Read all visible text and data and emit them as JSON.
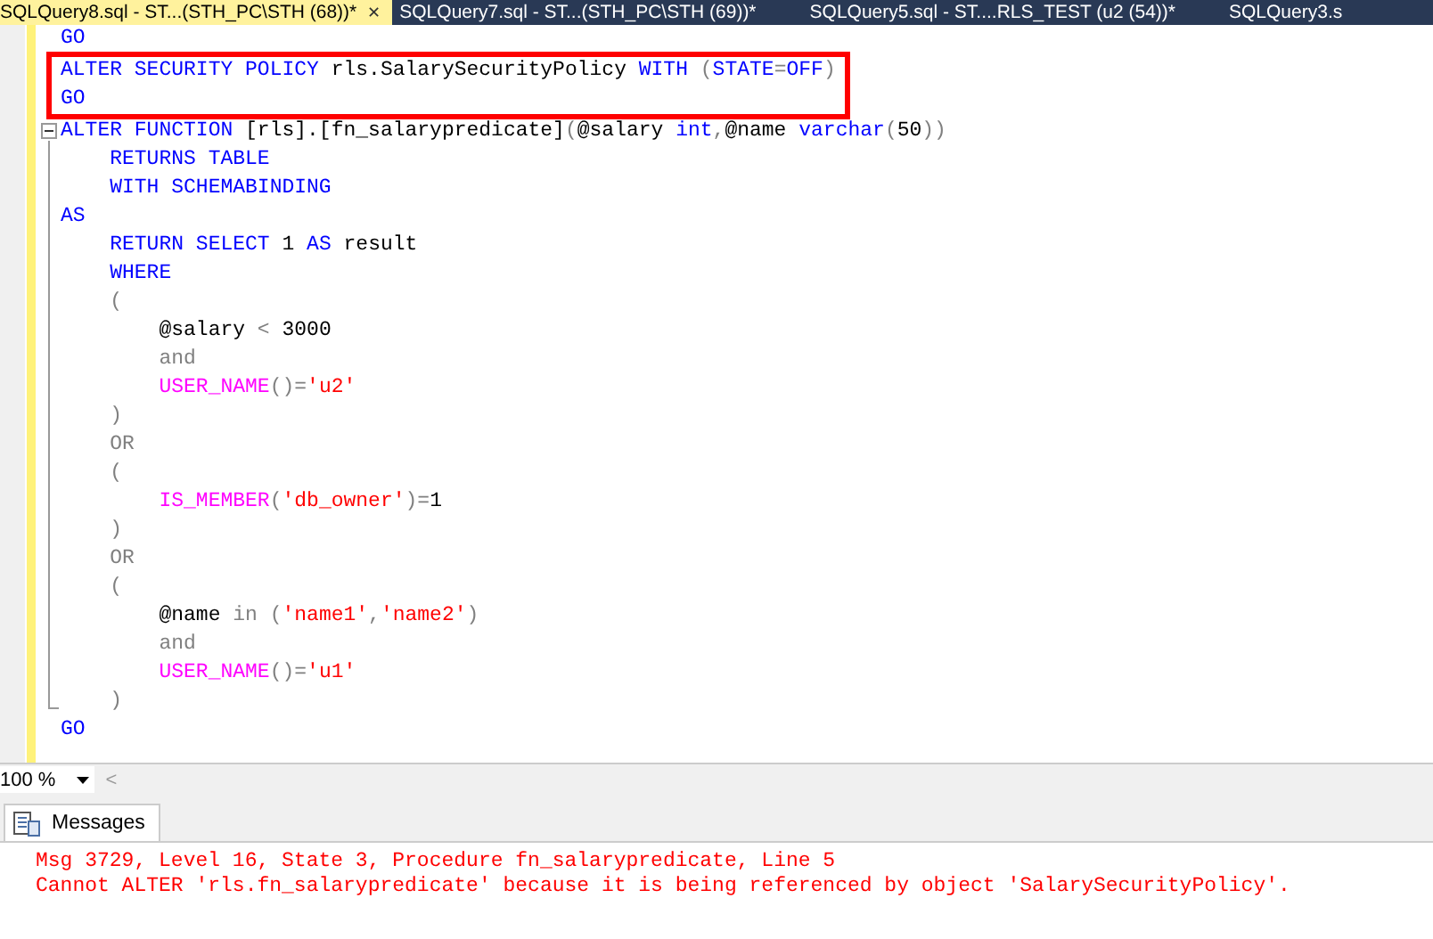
{
  "tabs": [
    {
      "label": "SQLQuery8.sql - ST...(STH_PC\\STH (68))*",
      "selected": true,
      "close": "✕"
    },
    {
      "label": "SQLQuery7.sql - ST...(STH_PC\\STH (69))*",
      "selected": false
    },
    {
      "label": "SQLQuery5.sql - ST....RLS_TEST (u2 (54))*",
      "selected": false
    },
    {
      "label": "SQLQuery3.s",
      "selected": false
    }
  ],
  "editor": {
    "sections": [
      {
        "highlighted": false,
        "foldable": false,
        "lines": [
          [
            {
              "text": "GO",
              "kind": "keyword"
            }
          ]
        ]
      },
      {
        "highlighted": true,
        "foldable": false,
        "lines": [
          [
            {
              "text": "ALTER SECURITY POLICY",
              "kind": "keyword"
            },
            {
              "text": " rls.SalarySecurityPolicy ",
              "kind": "plain"
            },
            {
              "text": "WITH",
              "kind": "keyword"
            },
            {
              "text": " (",
              "kind": "operator"
            },
            {
              "text": "STATE",
              "kind": "keyword"
            },
            {
              "text": "=",
              "kind": "operator"
            },
            {
              "text": "OFF",
              "kind": "keyword"
            },
            {
              "text": ")",
              "kind": "operator"
            }
          ],
          [
            {
              "text": "GO",
              "kind": "keyword"
            }
          ]
        ]
      },
      {
        "highlighted": false,
        "foldable": true,
        "lines": [
          [
            {
              "text": "ALTER FUNCTION",
              "kind": "keyword"
            },
            {
              "text": " [rls].[fn_salarypredicate]",
              "kind": "plain"
            },
            {
              "text": "(",
              "kind": "operator"
            },
            {
              "text": "@salary",
              "kind": "plain"
            },
            {
              "text": " int",
              "kind": "keyword"
            },
            {
              "text": ",",
              "kind": "operator"
            },
            {
              "text": "@name",
              "kind": "plain"
            },
            {
              "text": " varchar",
              "kind": "keyword"
            },
            {
              "text": "(",
              "kind": "operator"
            },
            {
              "text": "50",
              "kind": "plain"
            },
            {
              "text": "))",
              "kind": "operator"
            }
          ],
          [
            {
              "text": "    RETURNS TABLE",
              "kind": "keyword"
            }
          ],
          [
            {
              "text": "    WITH SCHEMABINDING",
              "kind": "keyword"
            }
          ],
          [
            {
              "text": "AS",
              "kind": "keyword"
            }
          ],
          [
            {
              "text": "    RETURN SELECT",
              "kind": "keyword"
            },
            {
              "text": " 1 ",
              "kind": "plain"
            },
            {
              "text": "AS",
              "kind": "keyword"
            },
            {
              "text": " result",
              "kind": "plain"
            }
          ],
          [
            {
              "text": "    WHERE",
              "kind": "keyword"
            }
          ],
          [
            {
              "text": "    (",
              "kind": "operator"
            }
          ],
          [
            {
              "text": "        @salary",
              "kind": "plain"
            },
            {
              "text": " < ",
              "kind": "operator"
            },
            {
              "text": "3000",
              "kind": "plain"
            }
          ],
          [
            {
              "text": "        and",
              "kind": "operator"
            }
          ],
          [
            {
              "text": "        USER_NAME",
              "kind": "function"
            },
            {
              "text": "()=",
              "kind": "operator"
            },
            {
              "text": "'u2'",
              "kind": "string"
            }
          ],
          [
            {
              "text": "    )",
              "kind": "operator"
            }
          ],
          [
            {
              "text": "    OR",
              "kind": "operator"
            }
          ],
          [
            {
              "text": "    (",
              "kind": "operator"
            }
          ],
          [
            {
              "text": "        IS_MEMBER",
              "kind": "function"
            },
            {
              "text": "(",
              "kind": "operator"
            },
            {
              "text": "'db_owner'",
              "kind": "string"
            },
            {
              "text": ")=",
              "kind": "operator"
            },
            {
              "text": "1",
              "kind": "plain"
            }
          ],
          [
            {
              "text": "    )",
              "kind": "operator"
            }
          ],
          [
            {
              "text": "    OR",
              "kind": "operator"
            }
          ],
          [
            {
              "text": "    (",
              "kind": "operator"
            }
          ],
          [
            {
              "text": "        @name",
              "kind": "plain"
            },
            {
              "text": " in (",
              "kind": "operator"
            },
            {
              "text": "'name1'",
              "kind": "string"
            },
            {
              "text": ",",
              "kind": "operator"
            },
            {
              "text": "'name2'",
              "kind": "string"
            },
            {
              "text": ")",
              "kind": "operator"
            }
          ],
          [
            {
              "text": "        and",
              "kind": "operator"
            }
          ],
          [
            {
              "text": "        USER_NAME",
              "kind": "function"
            },
            {
              "text": "()=",
              "kind": "operator"
            },
            {
              "text": "'u1'",
              "kind": "string"
            }
          ],
          [
            {
              "text": "    )",
              "kind": "operator"
            }
          ]
        ]
      },
      {
        "highlighted": false,
        "foldable": false,
        "lines": [
          [
            {
              "text": "GO",
              "kind": "keyword"
            }
          ]
        ]
      }
    ]
  },
  "zoom": {
    "value": "100 %",
    "scroll_left": "<"
  },
  "results": {
    "tab": "Messages",
    "messages": [
      "Msg 3729, Level 16, State 3, Procedure fn_salarypredicate, Line 5",
      "Cannot ALTER 'rls.fn_salarypredicate' because it is being referenced by object 'SalarySecurityPolicy'."
    ]
  }
}
